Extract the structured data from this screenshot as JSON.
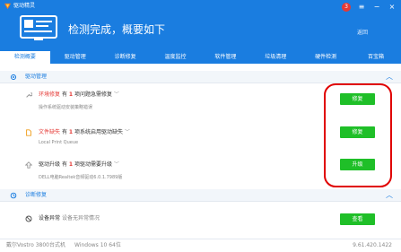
{
  "app": {
    "name": "驱动精灵"
  },
  "header": {
    "headline": "检测完成，概要如下",
    "back_label": "返回"
  },
  "window_controls": {
    "badge": "3",
    "menu": "≡",
    "minimize": "−",
    "close": "×"
  },
  "tabs": [
    {
      "label": "检测概要",
      "active": true
    },
    {
      "label": "驱动管理",
      "active": false
    },
    {
      "label": "诊断修复",
      "active": false
    },
    {
      "label": "温度监控",
      "active": false
    },
    {
      "label": "软件管理",
      "active": false
    },
    {
      "label": "垃圾清理",
      "active": false
    },
    {
      "label": "硬件检测",
      "active": false
    },
    {
      "label": "百宝箱",
      "active": false
    }
  ],
  "driver_section": {
    "title": "驱动管理",
    "items": [
      {
        "label": "环境修复",
        "pre": "有",
        "count": "1",
        "post": "项问题急需修复",
        "detail": "操作系统驱动安装策略错误",
        "button": "修复"
      },
      {
        "label": "文件缺失",
        "pre": "有",
        "count": "1",
        "post": "项系统启用驱动缺失",
        "detail": "Local Print Queue",
        "button": "修复"
      },
      {
        "label": "驱动升级",
        "pre": "有",
        "count": "1",
        "post": "项驱动需要升级",
        "detail": "DELL电脑Realtek音频驱动6.0.1.7989版",
        "button": "升级"
      }
    ]
  },
  "diag_section": {
    "title": "诊断修复",
    "items": [
      {
        "label": "设备异常",
        "text": "设备无异常情况",
        "button": "查看"
      }
    ]
  },
  "footer": {
    "model": "戴尔Vostro 3800台式机",
    "os": "Windows 10 64位",
    "version": "9.61.420.1422"
  },
  "colors": {
    "brand": "#1a7de0",
    "action": "#1fbf28",
    "alert": "#e53935",
    "highlight": "#e00000"
  }
}
